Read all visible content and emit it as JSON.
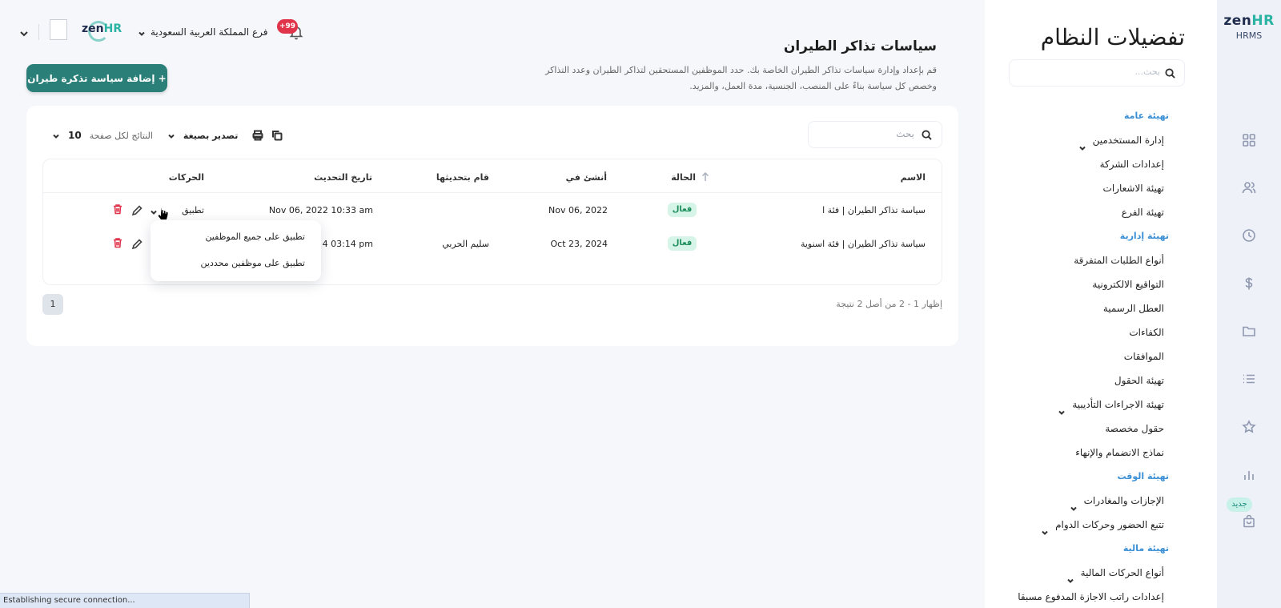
{
  "brand": {
    "logo_main": "zen",
    "logo_accent": "HR",
    "sub": "HRMS"
  },
  "rail": {
    "icons": [
      "dashboard-icon",
      "users-icon",
      "clock-icon",
      "dollar-icon",
      "folder-icon",
      "list-icon",
      "star-icon",
      "chart-icon",
      "bag-icon"
    ],
    "new_badge": "جديد"
  },
  "settings": {
    "title": "تفضيلات النظام",
    "search_placeholder": "بحث...",
    "nav": [
      {
        "type": "section",
        "label": "تهيئة عامة"
      },
      {
        "type": "item",
        "label": "إدارة المستخدمين",
        "chevron": true
      },
      {
        "type": "item",
        "label": "إعدادات الشركة"
      },
      {
        "type": "item",
        "label": "تهيئة الاشعارات"
      },
      {
        "type": "item",
        "label": "تهيئة الفرع"
      },
      {
        "type": "section",
        "label": "تهيئة إدارية"
      },
      {
        "type": "item",
        "label": "أنواع الطلبات المتفرقة"
      },
      {
        "type": "item",
        "label": "التواقيع الالكترونية"
      },
      {
        "type": "item",
        "label": "العطل الرسمية"
      },
      {
        "type": "item",
        "label": "الكفاءات"
      },
      {
        "type": "item",
        "label": "الموافقات"
      },
      {
        "type": "item",
        "label": "تهيئة الحقول"
      },
      {
        "type": "item",
        "label": "تهيئة الاجراءات التأديبية",
        "chevron": true
      },
      {
        "type": "item",
        "label": "حقول مخصصة"
      },
      {
        "type": "item",
        "label": "نماذج الانضمام والإنهاء"
      },
      {
        "type": "section",
        "label": "تهيئة الوقت"
      },
      {
        "type": "item",
        "label": "الإجازات والمغادرات",
        "chevron": true
      },
      {
        "type": "item",
        "label": "تتبع الحضور وحركات الدوام",
        "chevron": true
      },
      {
        "type": "section",
        "label": "تهيئة مالية"
      },
      {
        "type": "item",
        "label": "أنواع الحركات المالية",
        "chevron": true
      },
      {
        "type": "item",
        "label": "إعدادات راتب الاجازة المدفوع مسبقا"
      }
    ]
  },
  "topbar": {
    "org_logo_main": "zen",
    "org_logo_accent": "HR",
    "branch": "فرع المملكة العربية السعودية",
    "notifications": "+99"
  },
  "page": {
    "title": "سياسات تذاكر الطيران",
    "description": "قم بإعداد وإدارة سياسات تذاكر الطيران الخاصة بك. حدد الموظفين المستحقين لتذاكر الطيران وعدد التذاكر وخصص كل سياسة بناءً على المنصب، الجنسية، مدة العمل، والمزيد.",
    "add_button": "+ إضافة سياسة تذكرة طيران"
  },
  "toolbar": {
    "search_placeholder": "بحث",
    "per_page_value": "10",
    "per_page_label": "النتائج لكل صفحة",
    "export_label": "تصدير بصيغة"
  },
  "table": {
    "headers": {
      "name": "الاسم",
      "status": "الحالة",
      "created": "أنشئ في",
      "updated_by": "قام بتحديثها",
      "updated_at": "تاريخ التحديث",
      "actions": "الحركات"
    },
    "rows": [
      {
        "name": "سياسة تذاكر الطيران | فئة ا",
        "status": "فعال",
        "created": "Nov 06, 2022",
        "updated_by": "",
        "updated_at": "Nov 06, 2022 10:33 am",
        "action": "تطبيق"
      },
      {
        "name": "سياسة تذاكر الطيران | فئة اسنوية",
        "status": "فعال",
        "created": "Oct 23, 2024",
        "updated_by": "سليم الحربي",
        "updated_at": "4 03:14 pm",
        "action": ""
      }
    ]
  },
  "dropdown": {
    "items": [
      "تطبيق على جميع الموظفين",
      "تطبيق على موظفين محددين"
    ]
  },
  "pagination": {
    "page": "1",
    "summary": "إظهار 1 - 2 من أصل 2 نتيجة"
  },
  "browser_status": "Establishing secure connection..."
}
